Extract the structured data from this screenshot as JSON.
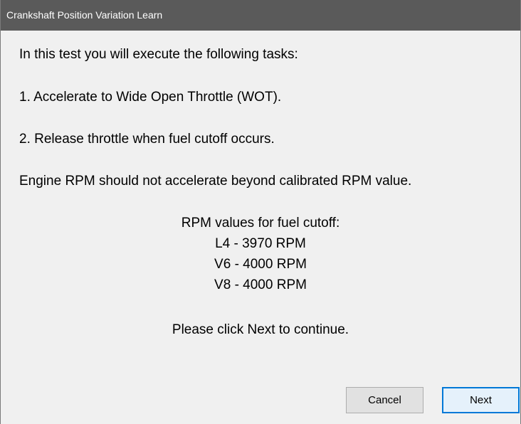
{
  "window": {
    "title": "Crankshaft Position Variation Learn"
  },
  "body": {
    "intro": "In this test you will execute the following tasks:",
    "step1": "1. Accelerate to Wide Open Throttle (WOT).",
    "step2": "2. Release throttle when fuel cutoff occurs.",
    "warning": "Engine RPM should not accelerate beyond calibrated RPM value.",
    "rpm_heading": "RPM values for fuel cutoff:",
    "rpm_values": [
      "L4 - 3970 RPM",
      "V6 - 4000 RPM",
      "V8 - 4000 RPM"
    ],
    "instruction": "Please click Next to continue."
  },
  "buttons": {
    "cancel": "Cancel",
    "next": "Next"
  },
  "colors": {
    "titlebar": "#5a5a5a",
    "background": "#f0f0f0",
    "focus_border": "#0078d7"
  }
}
